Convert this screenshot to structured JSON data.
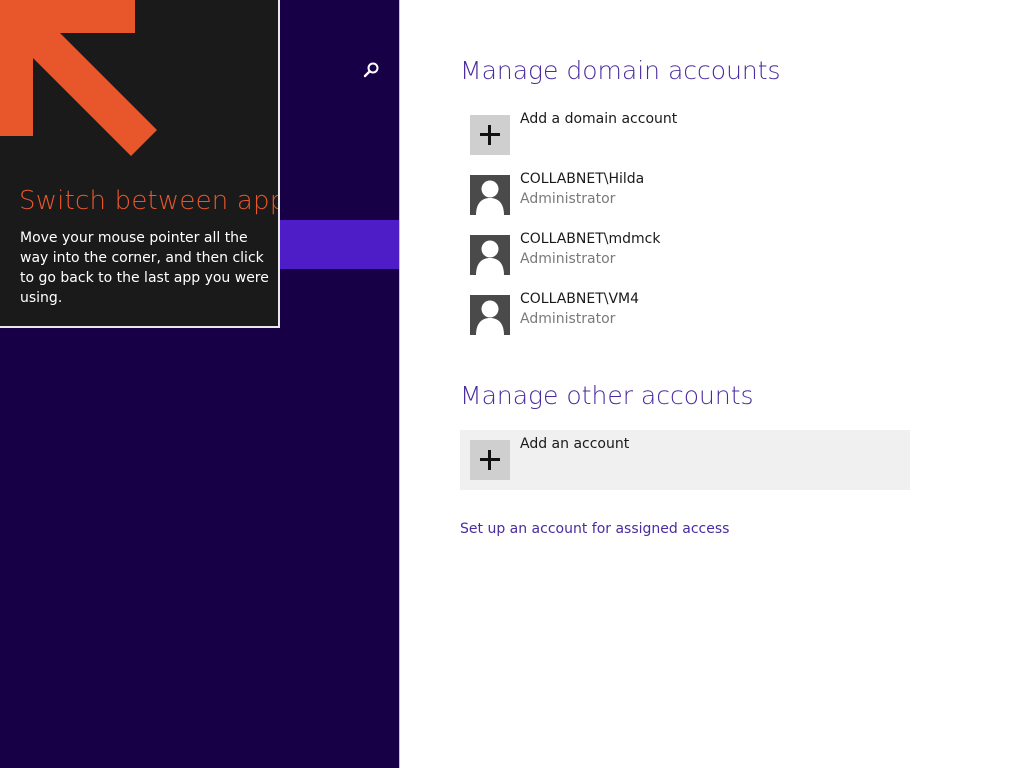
{
  "tip": {
    "title": "Switch between apps",
    "body_lines": [
      "Move your mouse pointer all the",
      "way into the corner, and then click",
      "to go back to the last app you were",
      "using."
    ],
    "arrow_color": "#e8562c"
  },
  "left_pane": {
    "search_icon": "search-icon",
    "background": "#180046",
    "selected_color": "#4f1dc7"
  },
  "domain_section": {
    "title": "Manage domain accounts",
    "add_label": "Add a domain account",
    "accounts": [
      {
        "name": "COLLABNET\\Hilda",
        "role": "Administrator"
      },
      {
        "name": "COLLABNET\\mdmck",
        "role": "Administrator"
      },
      {
        "name": "COLLABNET\\VM4",
        "role": "Administrator"
      }
    ]
  },
  "other_section": {
    "title": "Manage other accounts",
    "add_label": "Add an account"
  },
  "assigned_access_link": "Set up an account for assigned access",
  "colors": {
    "accent": "#4a2ca0",
    "tip_title": "#e8562c"
  }
}
